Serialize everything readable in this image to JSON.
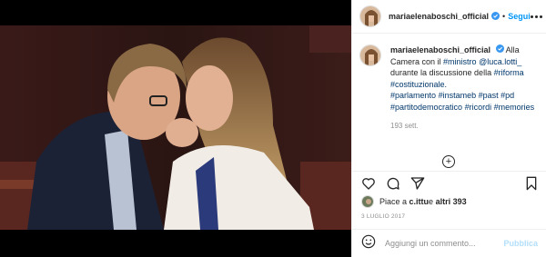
{
  "header": {
    "username": "mariaelenaboschi_official",
    "separator": "•",
    "follow_label": "Segui"
  },
  "caption": {
    "username": "mariaelenaboschi_official",
    "text_1": "Alla Camera con il ",
    "tag_ministro": "#ministro",
    "mention": "@luca.lotti_",
    "text_2": " durante la discussione della ",
    "tag_riforma": "#riforma",
    "tag_costituzionale": "#costituzionale.",
    "tag_parlamento": "#parlamento",
    "tag_instameb": "#instameb",
    "tag_past": "#past",
    "tag_pd": "#pd",
    "tag_partito": "#partitodemocratico",
    "tag_ricordi": "#ricordi",
    "tag_memories": "#memories",
    "time_ago": "193 sett."
  },
  "load_more_label": "+",
  "likes": {
    "prefix": "Piace a ",
    "user": "c.ittu",
    "middle": " e ",
    "others": "altri 393"
  },
  "date": "3 LUGLIO 2017",
  "comment": {
    "placeholder": "Aggiungi un commento...",
    "publish_label": "Pubblica"
  },
  "icons": {
    "like": "heart-icon",
    "comment": "comment-icon",
    "share": "share-icon",
    "save": "bookmark-icon",
    "emoji": "emoji-icon",
    "verified": "verified-badge-icon",
    "tag": "user-tag-icon"
  },
  "colors": {
    "accent": "#0095f6",
    "hashtag": "#00376b",
    "muted": "#8e8e8e",
    "publish_disabled": "#b2dffc"
  }
}
